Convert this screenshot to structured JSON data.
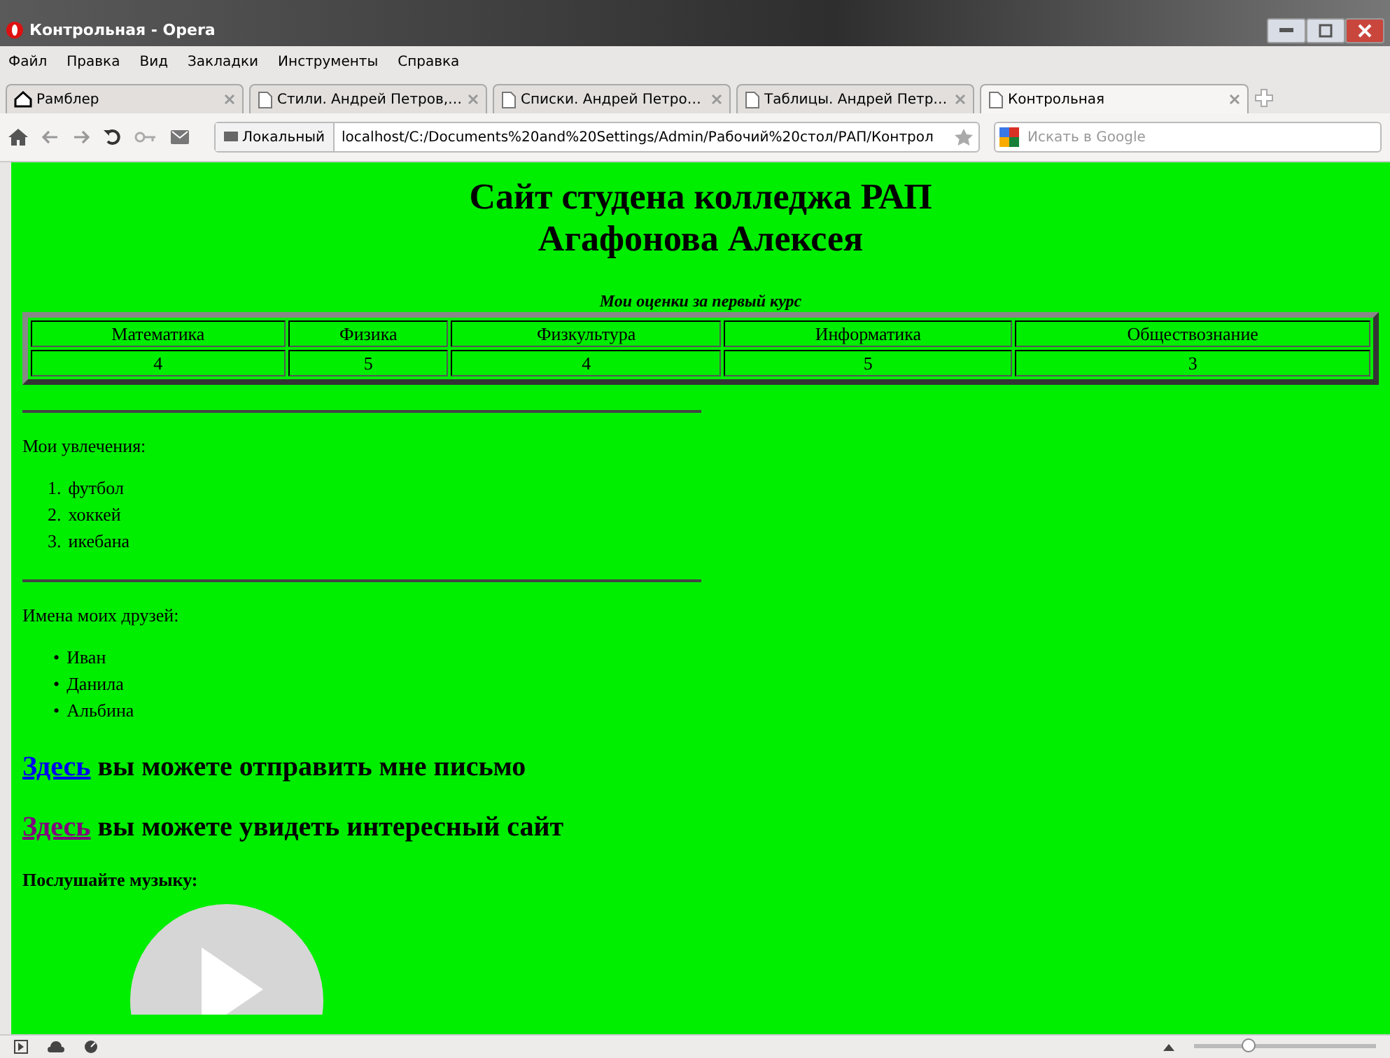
{
  "window": {
    "title": "Контрольная - Opera"
  },
  "menu": [
    "Файл",
    "Правка",
    "Вид",
    "Закладки",
    "Инструменты",
    "Справка"
  ],
  "tabs": [
    {
      "label": "Рамблер",
      "kind": "home",
      "selected": false
    },
    {
      "label": "Стили. Андрей Петров,…",
      "kind": "page",
      "selected": false
    },
    {
      "label": "Списки. Андрей Петро…",
      "kind": "page",
      "selected": false
    },
    {
      "label": "Таблицы. Андрей Петр…",
      "kind": "page",
      "selected": false
    },
    {
      "label": "Контрольная",
      "kind": "page",
      "selected": true
    }
  ],
  "address_bar": {
    "badge": "Локальный",
    "url": "localhost/C:/Documents%20and%20Settings/Admin/Рабочий%20стол/РАП/Контрол"
  },
  "search": {
    "placeholder": "Искать в Google"
  },
  "page": {
    "heading": [
      "Сайт студена колледжа РАП",
      "Агафонова Алексея"
    ],
    "table": {
      "caption": "Мои оценки за первый курс",
      "columns": [
        "Математика",
        "Физика",
        "Физкультура",
        "Информатика",
        "Обществознание"
      ],
      "rows": [
        [
          "4",
          "5",
          "4",
          "5",
          "3"
        ]
      ]
    },
    "hobbies_label": "Мои увлечения:",
    "hobbies": [
      {
        "marker": "1.",
        "text": "футбол"
      },
      {
        "marker": "2.",
        "text": "хоккей"
      },
      {
        "marker": "3.",
        "text": "икебана"
      }
    ],
    "friends_label": "Имена моих друзей:",
    "friends": [
      {
        "marker": "•",
        "text": "Иван"
      },
      {
        "marker": "•",
        "text": "Данила"
      },
      {
        "marker": "•",
        "text": "Альбина"
      }
    ],
    "links": [
      {
        "link": "Здесь",
        "text": " вы можете отправить мне письмо",
        "visited": false
      },
      {
        "link": "Здесь",
        "text": " вы можете увидеть интересный сайт",
        "visited": true
      }
    ],
    "music_label": "Послушайте музыку:"
  },
  "status_bar": {
    "zoom": {
      "level": 0.3
    }
  }
}
